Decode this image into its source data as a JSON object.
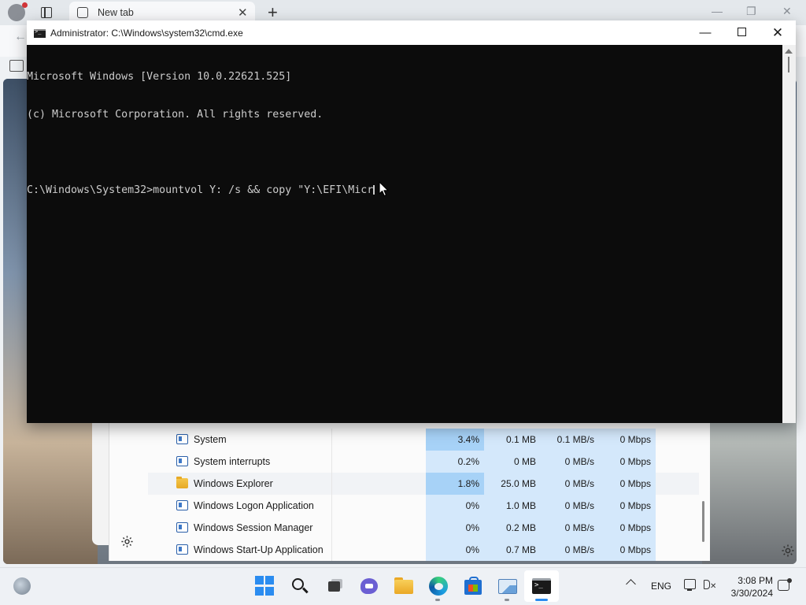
{
  "browser": {
    "tab_title": "New tab",
    "new_tab_glyph": "+",
    "close_tab_glyph": "✕",
    "back_glyph": "←",
    "window_controls": {
      "minimize": "—",
      "restore": "❐",
      "close": "✕"
    },
    "settings_icon": "gear-icon"
  },
  "cmd": {
    "title": "Administrator: C:\\Windows\\system32\\cmd.exe",
    "minimize_glyph": "—",
    "close_glyph": "✕",
    "lines": [
      "Microsoft Windows [Version 10.0.22621.525]",
      "(c) Microsoft Corporation. All rights reserved."
    ],
    "prompt": "C:\\Windows\\System32>",
    "command": "mountvol Y: /s && copy \"Y:\\EFI\\Micr"
  },
  "task_manager": {
    "rows": [
      {
        "name": "System",
        "icon": "app-window-icon",
        "cpu": "3.4%",
        "memory": "0.1 MB",
        "disk": "0.1 MB/s",
        "network": "0 Mbps",
        "cpu_hot": true,
        "highlight": false
      },
      {
        "name": "System interrupts",
        "icon": "app-window-icon",
        "cpu": "0.2%",
        "memory": "0 MB",
        "disk": "0 MB/s",
        "network": "0 Mbps",
        "cpu_hot": false,
        "highlight": false
      },
      {
        "name": "Windows Explorer",
        "icon": "folder-icon",
        "cpu": "1.8%",
        "memory": "25.0 MB",
        "disk": "0 MB/s",
        "network": "0 Mbps",
        "cpu_hot": true,
        "highlight": true
      },
      {
        "name": "Windows Logon Application",
        "icon": "app-window-icon",
        "cpu": "0%",
        "memory": "1.0 MB",
        "disk": "0 MB/s",
        "network": "0 Mbps",
        "cpu_hot": false,
        "highlight": false
      },
      {
        "name": "Windows Session Manager",
        "icon": "app-window-icon",
        "cpu": "0%",
        "memory": "0.2 MB",
        "disk": "0 MB/s",
        "network": "0 Mbps",
        "cpu_hot": false,
        "highlight": false
      },
      {
        "name": "Windows Start-Up Application",
        "icon": "app-window-icon",
        "cpu": "0%",
        "memory": "0.7 MB",
        "disk": "0 MB/s",
        "network": "0 Mbps",
        "cpu_hot": false,
        "highlight": false
      }
    ],
    "colors": {
      "cell": "#d4e8fb",
      "cell_hot": "#a7d2f7"
    }
  },
  "taskbar": {
    "apps": [
      "start-icon",
      "search-icon",
      "task-view-icon",
      "chat-icon",
      "file-explorer-icon",
      "edge-icon",
      "store-icon",
      "task-manager-icon",
      "cmd-icon"
    ],
    "tray": {
      "language": "ENG",
      "time": "3:08 PM",
      "date": "3/30/2024"
    }
  }
}
